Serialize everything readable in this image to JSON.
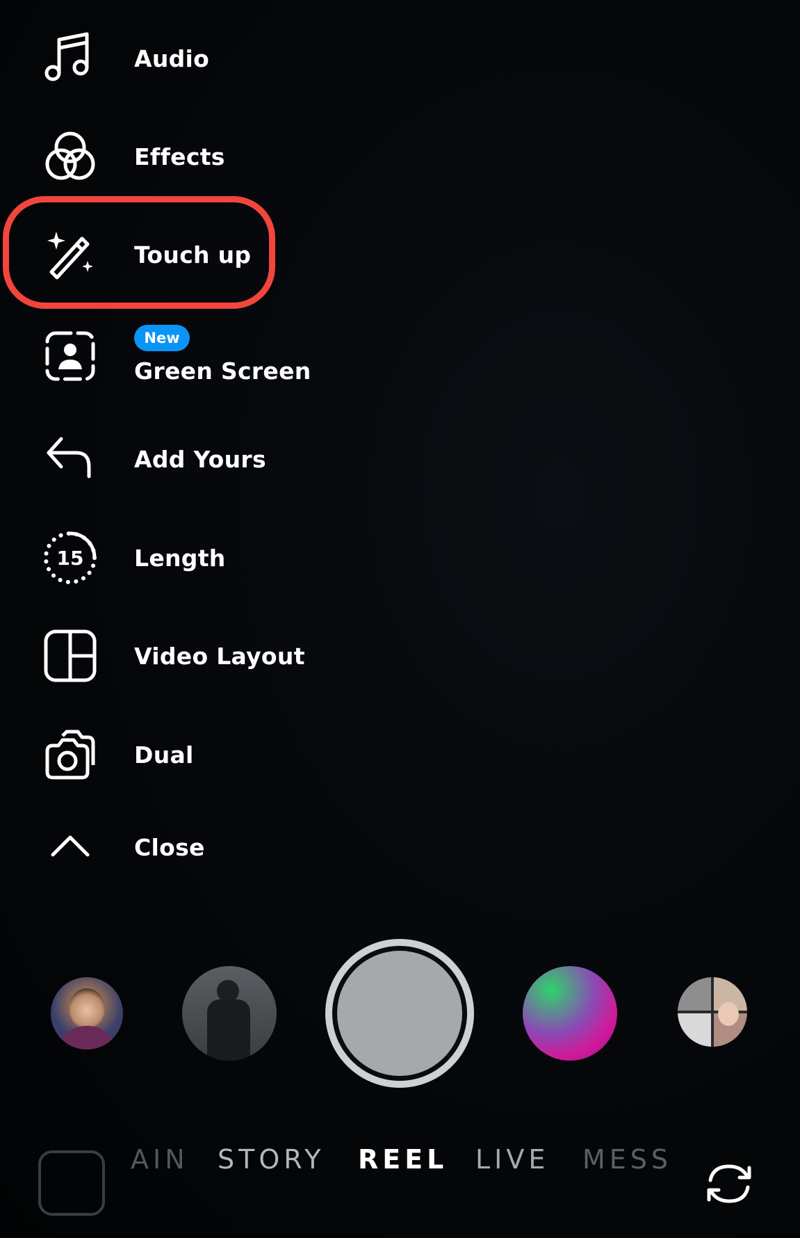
{
  "menu": {
    "items": [
      {
        "id": "audio",
        "label": "Audio",
        "icon": "music-note-icon"
      },
      {
        "id": "effects",
        "label": "Effects",
        "icon": "effects-icon"
      },
      {
        "id": "touch-up",
        "label": "Touch up",
        "icon": "magic-wand-icon",
        "highlighted": true
      },
      {
        "id": "green-screen",
        "label": "Green Screen",
        "icon": "person-frame-icon",
        "badge": "New"
      },
      {
        "id": "add-yours",
        "label": "Add Yours",
        "icon": "reply-arrow-icon"
      },
      {
        "id": "length",
        "label": "Length",
        "icon": "timer-icon",
        "icon_text": "15"
      },
      {
        "id": "video-layout",
        "label": "Video Layout",
        "icon": "layout-grid-icon"
      },
      {
        "id": "dual",
        "label": "Dual",
        "icon": "dual-camera-icon"
      },
      {
        "id": "close",
        "label": "Close",
        "icon": "chevron-up-icon"
      }
    ]
  },
  "modes": {
    "items": [
      "AIN",
      "STORY",
      "REEL",
      "LIVE",
      "MESS"
    ],
    "selected": "REEL"
  },
  "colors": {
    "highlight": "#f2453d",
    "badge": "#0a95f5",
    "background": "#040507"
  }
}
